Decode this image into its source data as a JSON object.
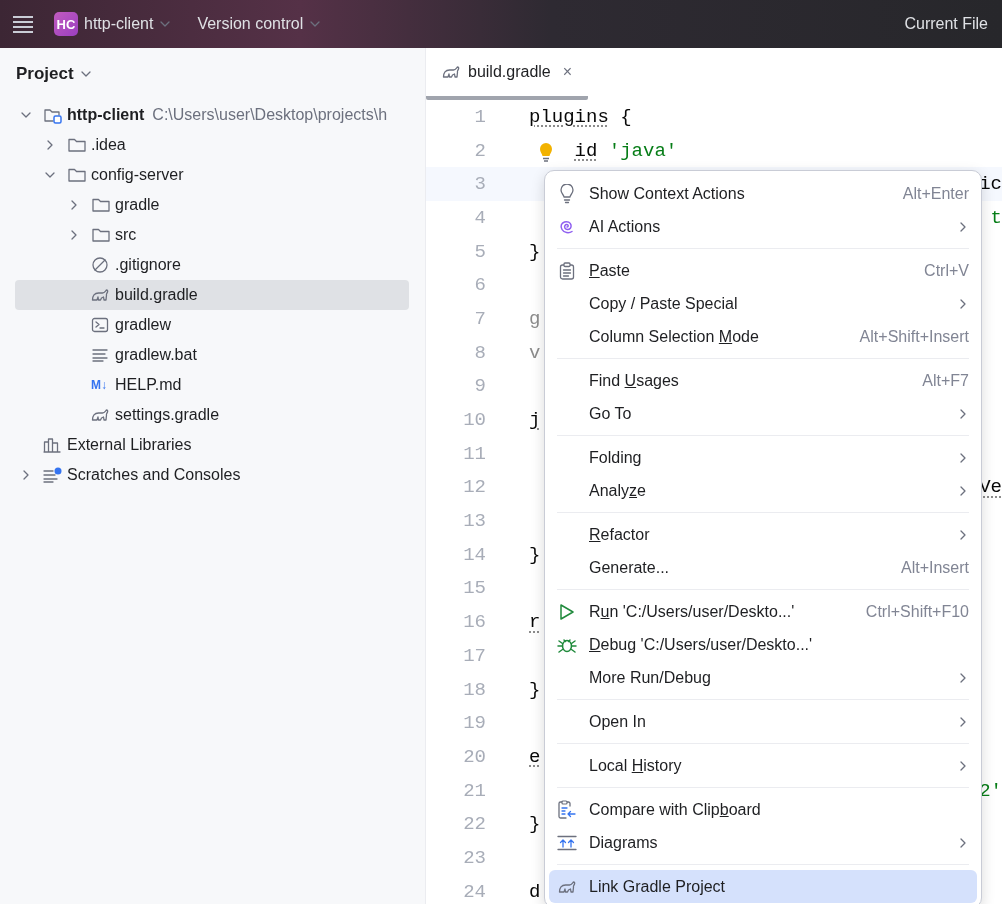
{
  "topbar": {
    "project_badge": "HC",
    "project": "http-client",
    "vcs": "Version control",
    "run_config": "Current File"
  },
  "project_panel": {
    "title": "Project",
    "tree": [
      {
        "name": "http-client",
        "path": "C:\\Users\\user\\Desktop\\projects\\h",
        "kind": "module",
        "expanded": true,
        "selected": false,
        "children": [
          {
            "name": ".idea",
            "kind": "folder",
            "expanded": false,
            "selected": false
          },
          {
            "name": "config-server",
            "kind": "folder",
            "expanded": true,
            "selected": false,
            "children": [
              {
                "name": "gradle",
                "kind": "folder",
                "expanded": false,
                "selected": false
              },
              {
                "name": "src",
                "kind": "folder",
                "expanded": false,
                "selected": false
              },
              {
                "name": ".gitignore",
                "kind": "ignore",
                "selected": false
              },
              {
                "name": "build.gradle",
                "kind": "gradle",
                "selected": true
              },
              {
                "name": "gradlew",
                "kind": "terminal",
                "selected": false
              },
              {
                "name": "gradlew.bat",
                "kind": "text",
                "selected": false
              },
              {
                "name": "HELP.md",
                "kind": "markdown",
                "badge": "M↓",
                "selected": false
              },
              {
                "name": "settings.gradle",
                "kind": "gradle",
                "selected": false
              }
            ]
          }
        ]
      },
      {
        "name": "External Libraries",
        "kind": "libraries",
        "selected": false
      },
      {
        "name": "Scratches and Consoles",
        "kind": "scratches",
        "expanded": false,
        "selected": false
      }
    ]
  },
  "editor": {
    "tabs": [
      {
        "label": "build.gradle",
        "close": "×",
        "selected": true
      }
    ],
    "lines": [
      {
        "number": "1",
        "kind": "plain",
        "code": [
          {
            "text": "plugins",
            "kind": "dotted"
          },
          {
            "text": " {",
            "kind": "plain"
          }
        ]
      },
      {
        "number": "2",
        "kind": "hint",
        "code": [
          {
            "text": "id",
            "kind": "dotted"
          },
          {
            "text": " 'java'",
            "kind": "string"
          }
        ]
      },
      {
        "number": "3",
        "kind": "current",
        "tail": [
          {
            "text": "ic",
            "kind": "plain"
          }
        ]
      },
      {
        "number": "4",
        "kind": "plain",
        "tail": [
          {
            "text": "t",
            "kind": "string"
          }
        ]
      },
      {
        "number": "5",
        "kind": "plain",
        "code": [
          {
            "text": "}",
            "kind": "plain"
          }
        ]
      },
      {
        "number": "6",
        "kind": "plain"
      },
      {
        "number": "7",
        "kind": "plain",
        "code": [
          {
            "text": "g",
            "kind": "muted"
          }
        ]
      },
      {
        "number": "8",
        "kind": "plain",
        "code": [
          {
            "text": "v",
            "kind": "muted"
          }
        ]
      },
      {
        "number": "9",
        "kind": "plain"
      },
      {
        "number": "10",
        "kind": "plain",
        "code": [
          {
            "text": "j",
            "kind": "dotted"
          }
        ]
      },
      {
        "number": "11",
        "kind": "plain"
      },
      {
        "number": "12",
        "kind": "plain",
        "tail": [
          {
            "text": "Ve",
            "kind": "dotted"
          }
        ]
      },
      {
        "number": "13",
        "kind": "plain"
      },
      {
        "number": "14",
        "kind": "plain",
        "code": [
          {
            "text": "}",
            "kind": "plain"
          }
        ]
      },
      {
        "number": "15",
        "kind": "plain"
      },
      {
        "number": "16",
        "kind": "plain",
        "code": [
          {
            "text": "r",
            "kind": "dotted"
          }
        ]
      },
      {
        "number": "17",
        "kind": "plain"
      },
      {
        "number": "18",
        "kind": "plain",
        "code": [
          {
            "text": "}",
            "kind": "plain"
          }
        ]
      },
      {
        "number": "19",
        "kind": "plain"
      },
      {
        "number": "20",
        "kind": "plain",
        "code": [
          {
            "text": "e",
            "kind": "dotted"
          }
        ]
      },
      {
        "number": "21",
        "kind": "plain",
        "tail": [
          {
            "text": "2'",
            "kind": "string"
          }
        ]
      },
      {
        "number": "22",
        "kind": "plain",
        "code": [
          {
            "text": "}",
            "kind": "plain"
          }
        ]
      },
      {
        "number": "23",
        "kind": "plain"
      },
      {
        "number": "24",
        "kind": "plain",
        "code": [
          {
            "text": "d",
            "kind": "plain"
          }
        ]
      }
    ]
  },
  "context_menu": {
    "groups": [
      [
        {
          "kind": "bulb",
          "label": "Show Context Actions",
          "shortcut": "Alt+Enter",
          "submenu": false,
          "selected": false
        },
        {
          "kind": "ai",
          "label": "AI Actions",
          "submenu": true,
          "selected": false
        }
      ],
      [
        {
          "kind": "paste",
          "mnemonic": "P",
          "label_rest": "aste",
          "shortcut": "Ctrl+V",
          "submenu": false,
          "selected": false
        },
        {
          "kind": "none",
          "label": "Copy / Paste Special",
          "submenu": true,
          "selected": false
        },
        {
          "kind": "none",
          "label": "Column Selection ",
          "mnemonic": "M",
          "label_rest": "ode",
          "shortcut": "Alt+Shift+Insert",
          "submenu": false,
          "selected": false
        }
      ],
      [
        {
          "kind": "none",
          "label": "Find ",
          "mnemonic": "U",
          "label_rest": "sages",
          "shortcut": "Alt+F7",
          "submenu": false,
          "selected": false
        },
        {
          "kind": "none",
          "label": "Go To",
          "submenu": true,
          "selected": false
        }
      ],
      [
        {
          "kind": "none",
          "label": "Folding",
          "submenu": true,
          "selected": false
        },
        {
          "kind": "none",
          "label": "Analy",
          "mnemonic": "z",
          "label_rest": "e",
          "submenu": true,
          "selected": false
        }
      ],
      [
        {
          "kind": "none",
          "mnemonic": "R",
          "label_rest": "efactor",
          "submenu": true,
          "selected": false
        },
        {
          "kind": "none",
          "label": "Generate...",
          "shortcut": "Alt+Insert",
          "submenu": false,
          "selected": false
        }
      ],
      [
        {
          "kind": "run",
          "label": "R",
          "mnemonic": "u",
          "label_rest": "n 'C:/Users/user/Deskto...'",
          "shortcut": "Ctrl+Shift+F10",
          "submenu": false,
          "selected": false
        },
        {
          "kind": "debug",
          "mnemonic": "D",
          "label_rest": "ebug 'C:/Users/user/Deskto...'",
          "submenu": false,
          "selected": false
        },
        {
          "kind": "none",
          "label": "More Run/Debug",
          "submenu": true,
          "selected": false
        }
      ],
      [
        {
          "kind": "none",
          "label": "Open In",
          "submenu": true,
          "selected": false
        }
      ],
      [
        {
          "kind": "none",
          "label": "Local ",
          "mnemonic": "H",
          "label_rest": "istory",
          "submenu": true,
          "selected": false
        }
      ],
      [
        {
          "kind": "compare",
          "label": "Compare with Clip",
          "mnemonic": "b",
          "label_rest": "oard",
          "submenu": false,
          "selected": false
        },
        {
          "kind": "diagrams",
          "label": "Diagrams",
          "submenu": true,
          "selected": false
        }
      ],
      [
        {
          "kind": "gradle",
          "label": "Link Gradle Project",
          "submenu": false,
          "selected": true
        }
      ]
    ]
  }
}
